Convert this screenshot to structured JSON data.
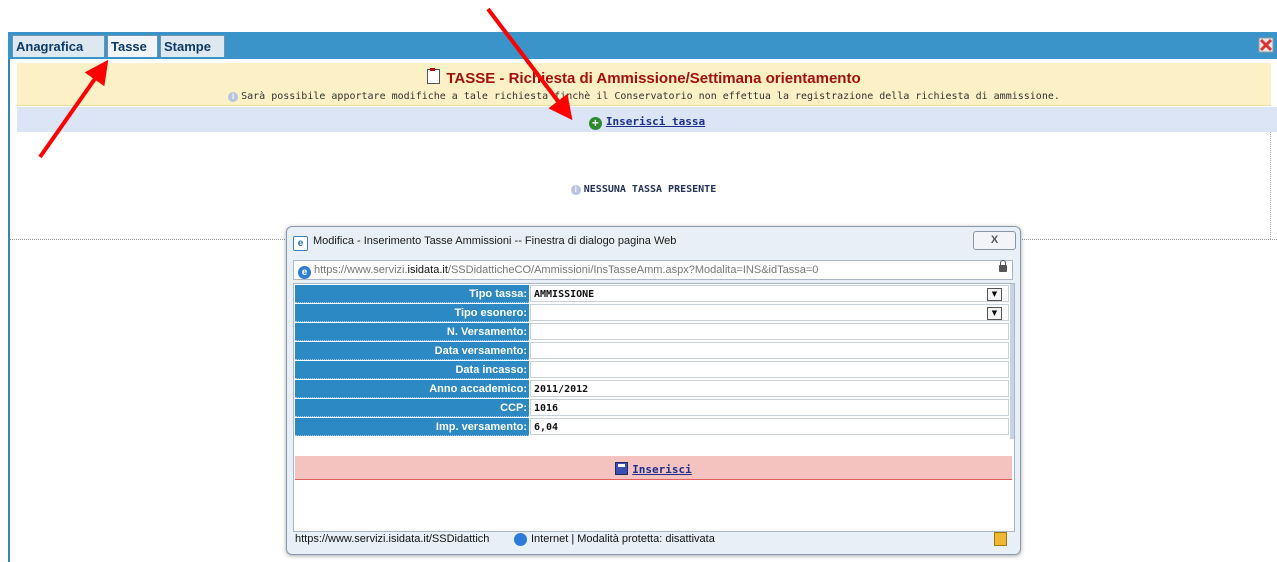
{
  "tabs": [
    {
      "label": "Anagrafica",
      "active": false
    },
    {
      "label": "Tasse",
      "active": true
    },
    {
      "label": "Stampe",
      "active": false
    }
  ],
  "page": {
    "title": "TASSE - Richiesta di Ammissione/Settimana orientamento",
    "note": "Sarà possibile apportare modifiche a tale richiesta finchè il Conservatorio non effettua la registrazione della richiesta di ammissione.",
    "add_link": "Inserisci tassa",
    "empty_message": "NESSUNA TASSA PRESENTE"
  },
  "dialog": {
    "title": "Modifica - Inserimento Tasse Ammissioni -- Finestra di dialogo pagina Web",
    "close_label": "X",
    "address_prefix": "https://www.servizi.",
    "address_domain": "isidata.it",
    "address_path": "/SSDidatticheCO/Ammissioni/InsTasseAmm.aspx?Modalita=INS&idTassa=0",
    "fields": [
      {
        "label": "Tipo tassa:",
        "value": "AMMISSIONE",
        "dropdown": true
      },
      {
        "label": "Tipo esonero:",
        "value": "",
        "dropdown": true
      },
      {
        "label": "N. Versamento:",
        "value": ""
      },
      {
        "label": "Data versamento:",
        "value": ""
      },
      {
        "label": "Data incasso:",
        "value": ""
      },
      {
        "label": "Anno accademico:",
        "value": "2011/2012"
      },
      {
        "label": "CCP:",
        "value": "1016"
      },
      {
        "label": "Imp. versamento:",
        "value": "6,04"
      }
    ],
    "save_link": "Inserisci",
    "status_url": "https://www.servizi.isidata.it/SSDidattich",
    "status_zone": "Internet | Modalità protetta: disattivata"
  },
  "colors": {
    "tabbar": "#3a93c9",
    "header_bg": "#fbf0c6",
    "title_red": "#a50f0f",
    "label_blue": "#2c89c4",
    "annotation_arrow": "#ff0000"
  }
}
